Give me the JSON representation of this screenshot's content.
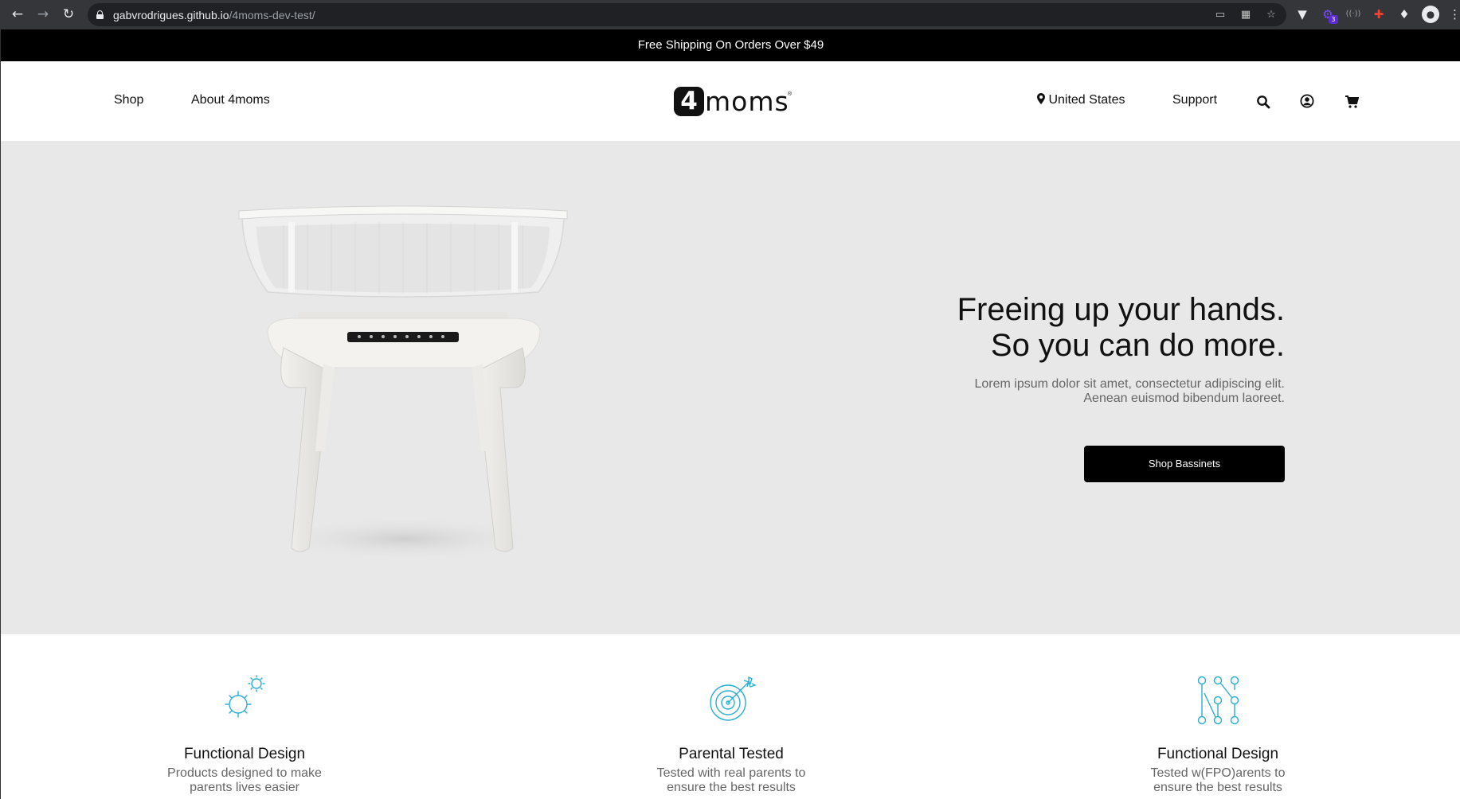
{
  "browser": {
    "url_host": "gabvrodrigues.github.io",
    "url_path": "/4moms-dev-test/",
    "back_icon": "arrow-left-icon",
    "forward_icon": "arrow-right-icon",
    "reload_icon": "reload-icon",
    "extension_badge": "3"
  },
  "promo": {
    "text": "Free Shipping On Orders Over $49"
  },
  "header": {
    "nav_left": [
      "Shop",
      "About 4moms"
    ],
    "logo": {
      "mark": "4",
      "word": "moms"
    },
    "location": "United States",
    "support": "Support"
  },
  "hero": {
    "headline_line1": "Freeing up your hands.",
    "headline_line2": "So you can do more.",
    "subtext_line1": "Lorem ipsum dolor sit amet, consectetur adipiscing elit.",
    "subtext_line2": "Aenean euismod bibendum laoreet.",
    "cta_label": "Shop Bassinets"
  },
  "features": [
    {
      "icon": "gears-icon",
      "title": "Functional Design",
      "desc_line1": "Products designed to make",
      "desc_line2": "parents lives easier"
    },
    {
      "icon": "target-icon",
      "title": "Parental Tested",
      "desc_line1": "Tested with real parents to",
      "desc_line2": "ensure the best results"
    },
    {
      "icon": "network-icon",
      "title": "Functional Design",
      "desc_line1": "Tested w(FPO)arents to",
      "desc_line2": "ensure the best results"
    }
  ],
  "colors": {
    "accent_icon": "#2aaed6",
    "hero_bg": "#e8e8e8",
    "promo_bg": "#000000"
  }
}
